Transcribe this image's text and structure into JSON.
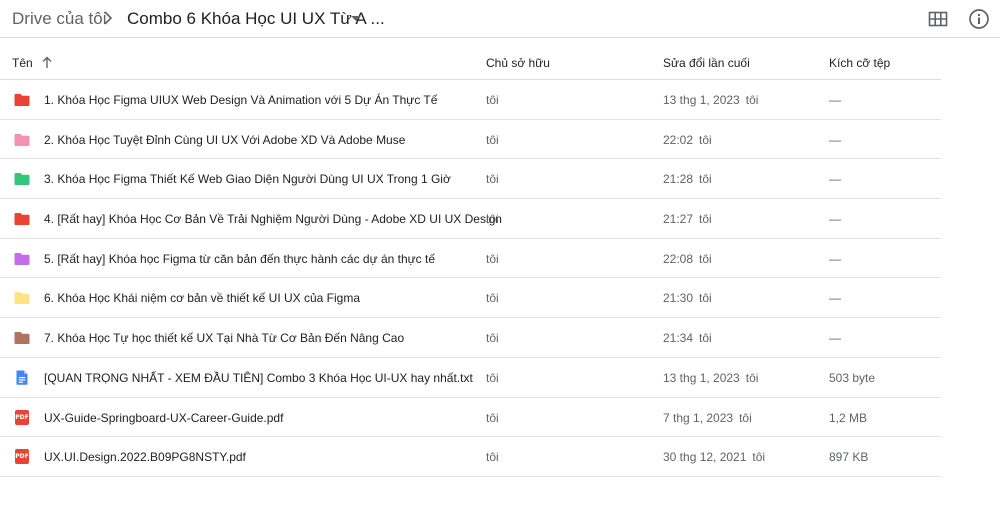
{
  "breadcrumb": {
    "root": "Drive của tôi",
    "current": "Combo 6 Khóa Học UI UX Từ A ..."
  },
  "toolbar": {
    "view_icon": "grid-view-icon",
    "info_icon": "info-icon"
  },
  "columns": {
    "name": "Tên",
    "owner": "Chủ sở hữu",
    "modified": "Sửa đổi lần cuối",
    "size": "Kích cỡ tệp"
  },
  "files": [
    {
      "name": "1. Khóa Học Figma UIUX Web Design Và Animation với 5 Dự Án Thực Tế",
      "owner": "tôi",
      "modified": "13 thg 1, 2023",
      "modified_by": "tôi",
      "size": "—",
      "type": "folder",
      "color": "#ea4335"
    },
    {
      "name": "2. Khóa Học Tuyệt Đỉnh Cùng UI UX Với Adobe XD Và Adobe Muse",
      "owner": "tôi",
      "modified": "22:02",
      "modified_by": "tôi",
      "size": "—",
      "type": "folder",
      "color": "#f691b2"
    },
    {
      "name": "3. Khóa Học Figma Thiết Kế Web Giao Diện Người Dùng UI UX Trong 1 Giờ",
      "owner": "tôi",
      "modified": "21:28",
      "modified_by": "tôi",
      "size": "—",
      "type": "folder",
      "color": "#34c77b"
    },
    {
      "name": "4. [Rất hay] Khóa Học Cơ Bản Về Trải Nghiệm Người Dùng - Adobe XD UI UX Design",
      "owner": "tôi",
      "modified": "21:27",
      "modified_by": "tôi",
      "size": "—",
      "type": "folder",
      "color": "#ea4335"
    },
    {
      "name": "5. [Rất hay] Khóa học Figma từ căn bản đến thực hành các dự án thực tế",
      "owner": "tôi",
      "modified": "22:08",
      "modified_by": "tôi",
      "size": "—",
      "type": "folder",
      "color": "#c36ee8"
    },
    {
      "name": "6. Khóa Học Khái niệm cơ bản về thiết kế UI UX của Figma",
      "owner": "tôi",
      "modified": "21:30",
      "modified_by": "tôi",
      "size": "—",
      "type": "folder",
      "color": "#fde383"
    },
    {
      "name": "7. Khóa Học Tự học thiết kế UX Tại Nhà Từ Cơ Bản Đến Nâng Cao",
      "owner": "tôi",
      "modified": "21:34",
      "modified_by": "tôi",
      "size": "—",
      "type": "folder",
      "color": "#b07360"
    },
    {
      "name": "[QUAN TRỌNG NHẤT - XEM ĐẦU TIÊN] Combo 3 Khóa Học UI-UX hay nhất.txt",
      "owner": "tôi",
      "modified": "13 thg 1, 2023",
      "modified_by": "tôi",
      "size": "503 byte",
      "type": "doc",
      "color": "#4285f4"
    },
    {
      "name": "UX-Guide-Springboard-UX-Career-Guide.pdf",
      "owner": "tôi",
      "modified": "7 thg 1, 2023",
      "modified_by": "tôi",
      "size": "1,2 MB",
      "type": "pdf",
      "color": "#ea4335"
    },
    {
      "name": "UX.UI.Design.2022.B09PG8NSTY.pdf",
      "owner": "tôi",
      "modified": "30 thg 12, 2021",
      "modified_by": "tôi",
      "size": "897 KB",
      "type": "pdf",
      "color": "#ea4335"
    }
  ]
}
